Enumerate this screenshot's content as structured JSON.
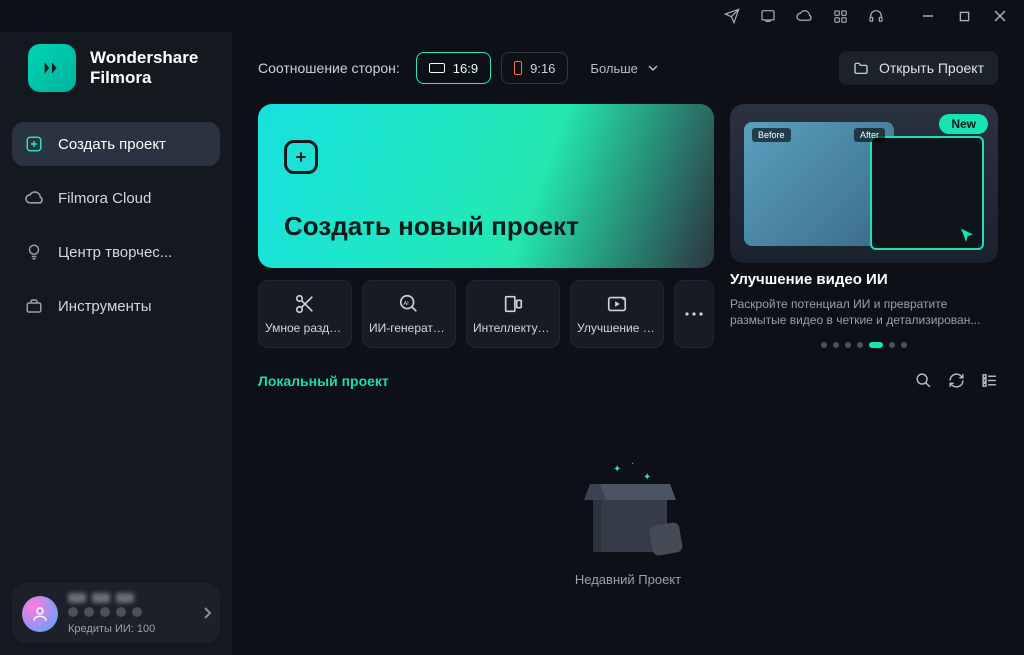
{
  "brand": {
    "line1": "Wondershare",
    "line2": "Filmora"
  },
  "sidebar": {
    "items": [
      {
        "label": "Создать проект"
      },
      {
        "label": "Filmora Cloud"
      },
      {
        "label": "Центр творчес..."
      },
      {
        "label": "Инструменты"
      }
    ],
    "credits_label": "Кредиты ИИ: 100"
  },
  "toolbar": {
    "aspect_label": "Соотношение сторон:",
    "ratio_16_9": "16:9",
    "ratio_9_16": "9:16",
    "more_label": "Больше",
    "open_project_label": "Открыть Проект"
  },
  "hero": {
    "create_project_label": "Создать новый проект"
  },
  "promo": {
    "new_badge": "New",
    "before_label": "Before",
    "after_label": "After",
    "title": "Улучшение видео ИИ",
    "description": "Раскройте потенциал ИИ и превратите размытые видео в четкие и детализирован..."
  },
  "tools": [
    {
      "label": "Умное раздел..."
    },
    {
      "label": "ИИ-генератор..."
    },
    {
      "label": "Интеллектуал..."
    },
    {
      "label": "Улучшение ви..."
    }
  ],
  "section": {
    "tab_local": "Локальный проект"
  },
  "empty": {
    "label": "Недавний Проект"
  }
}
